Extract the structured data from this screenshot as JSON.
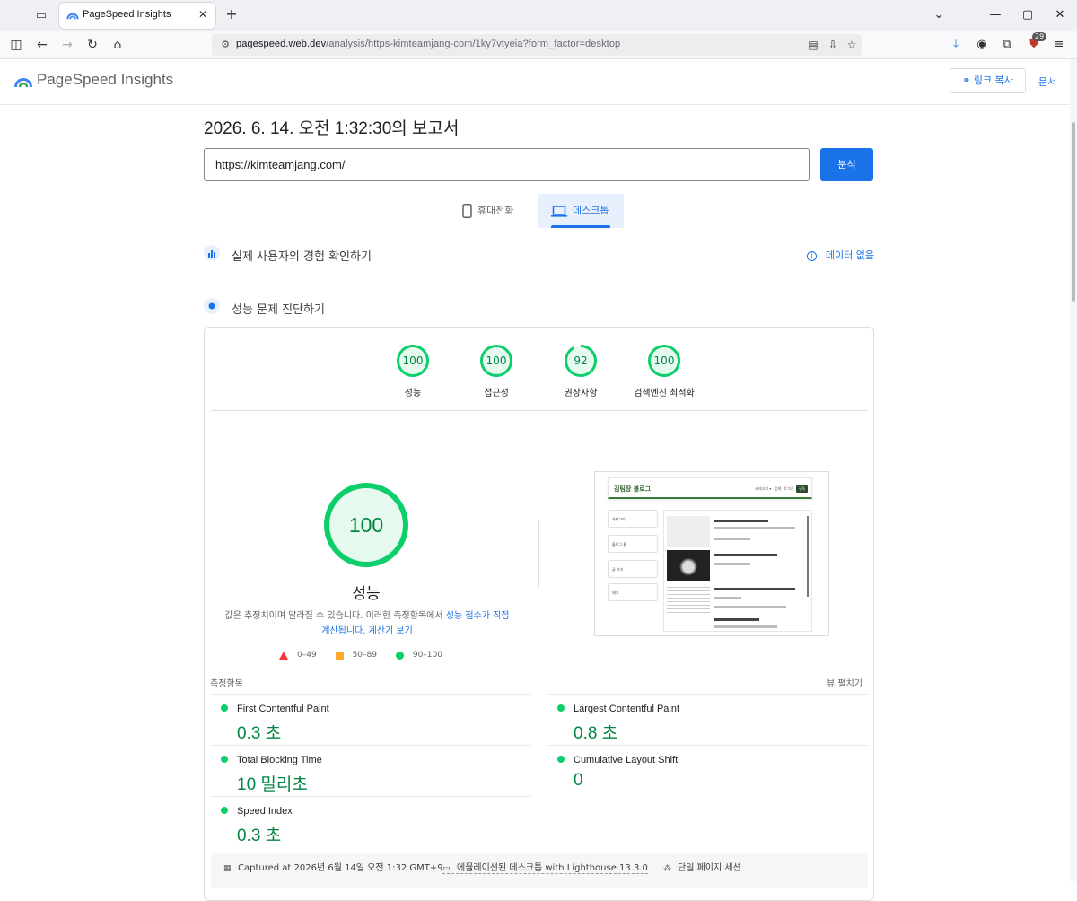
{
  "browser": {
    "tab_title": "PageSpeed Insights",
    "url_host": "pagespeed.web.dev",
    "url_path": "/analysis/https-kimteamjang-com/1ky7vtyeia?form_factor=desktop",
    "ext_badge": "29"
  },
  "header": {
    "brand": "PageSpeed Insights",
    "copy_link": "링크 복사",
    "docs": "문서"
  },
  "report": {
    "title": "2026. 6. 14. 오전 1:32:30의 보고서",
    "url_value": "https://kimteamjang.com/",
    "analyze": "분석"
  },
  "device_tabs": {
    "mobile": "휴대전화",
    "desktop": "데스크톱",
    "selected": "desktop"
  },
  "sections": {
    "crux_title": "실제 사용자의 경험 확인하기",
    "no_data": "데이터 없음",
    "diag_title": "성능 문제 진단하기"
  },
  "scores": [
    {
      "label": "성능",
      "value": 100
    },
    {
      "label": "접근성",
      "value": 100
    },
    {
      "label": "권장사항",
      "value": 92
    },
    {
      "label": "검색엔진 최적화",
      "value": 100
    }
  ],
  "performance": {
    "score": 100,
    "label": "성능",
    "disclaimer_prefix": "값은 추정치이며 달라질 수 있습니다. 이러한 측정항목에서 ",
    "disclaimer_link": "성능 점수가 직접 계산됩니다.",
    "calc_link": "계산기 보기",
    "legend": [
      "0–49",
      "50–89",
      "90–100"
    ]
  },
  "screenshot": {
    "site_title": "김팀장 블로그",
    "nav": [
      "카테고리 ▾",
      "검색",
      "로그인"
    ],
    "nav_button": "구독",
    "sidebar": [
      "카테고리",
      "블로그 홈",
      "글 쓰기",
      "태그"
    ]
  },
  "metrics": {
    "label": "측정항목",
    "expand": "뷰 펼치기",
    "items": [
      {
        "name": "First Contentful Paint",
        "value": "0.3 초"
      },
      {
        "name": "Largest Contentful Paint",
        "value": "0.8 초"
      },
      {
        "name": "Total Blocking Time",
        "value": "10 밀리초"
      },
      {
        "name": "Cumulative Layout Shift",
        "value": "0"
      },
      {
        "name": "Speed Index",
        "value": "0.3 초"
      }
    ]
  },
  "footer": {
    "captured": "Captured at 2026년 6월 14일 오전 1:32 GMT+9",
    "emulated": "에뮬레이션된 데스크톱 with Lighthouse 13.3.0",
    "session": "단일 페이지 세션"
  },
  "colors": {
    "pass": "#0cce6b",
    "pass_text": "#018642",
    "average": "#ffaa33",
    "fail": "#ff3333",
    "accent": "#1a73e8"
  }
}
